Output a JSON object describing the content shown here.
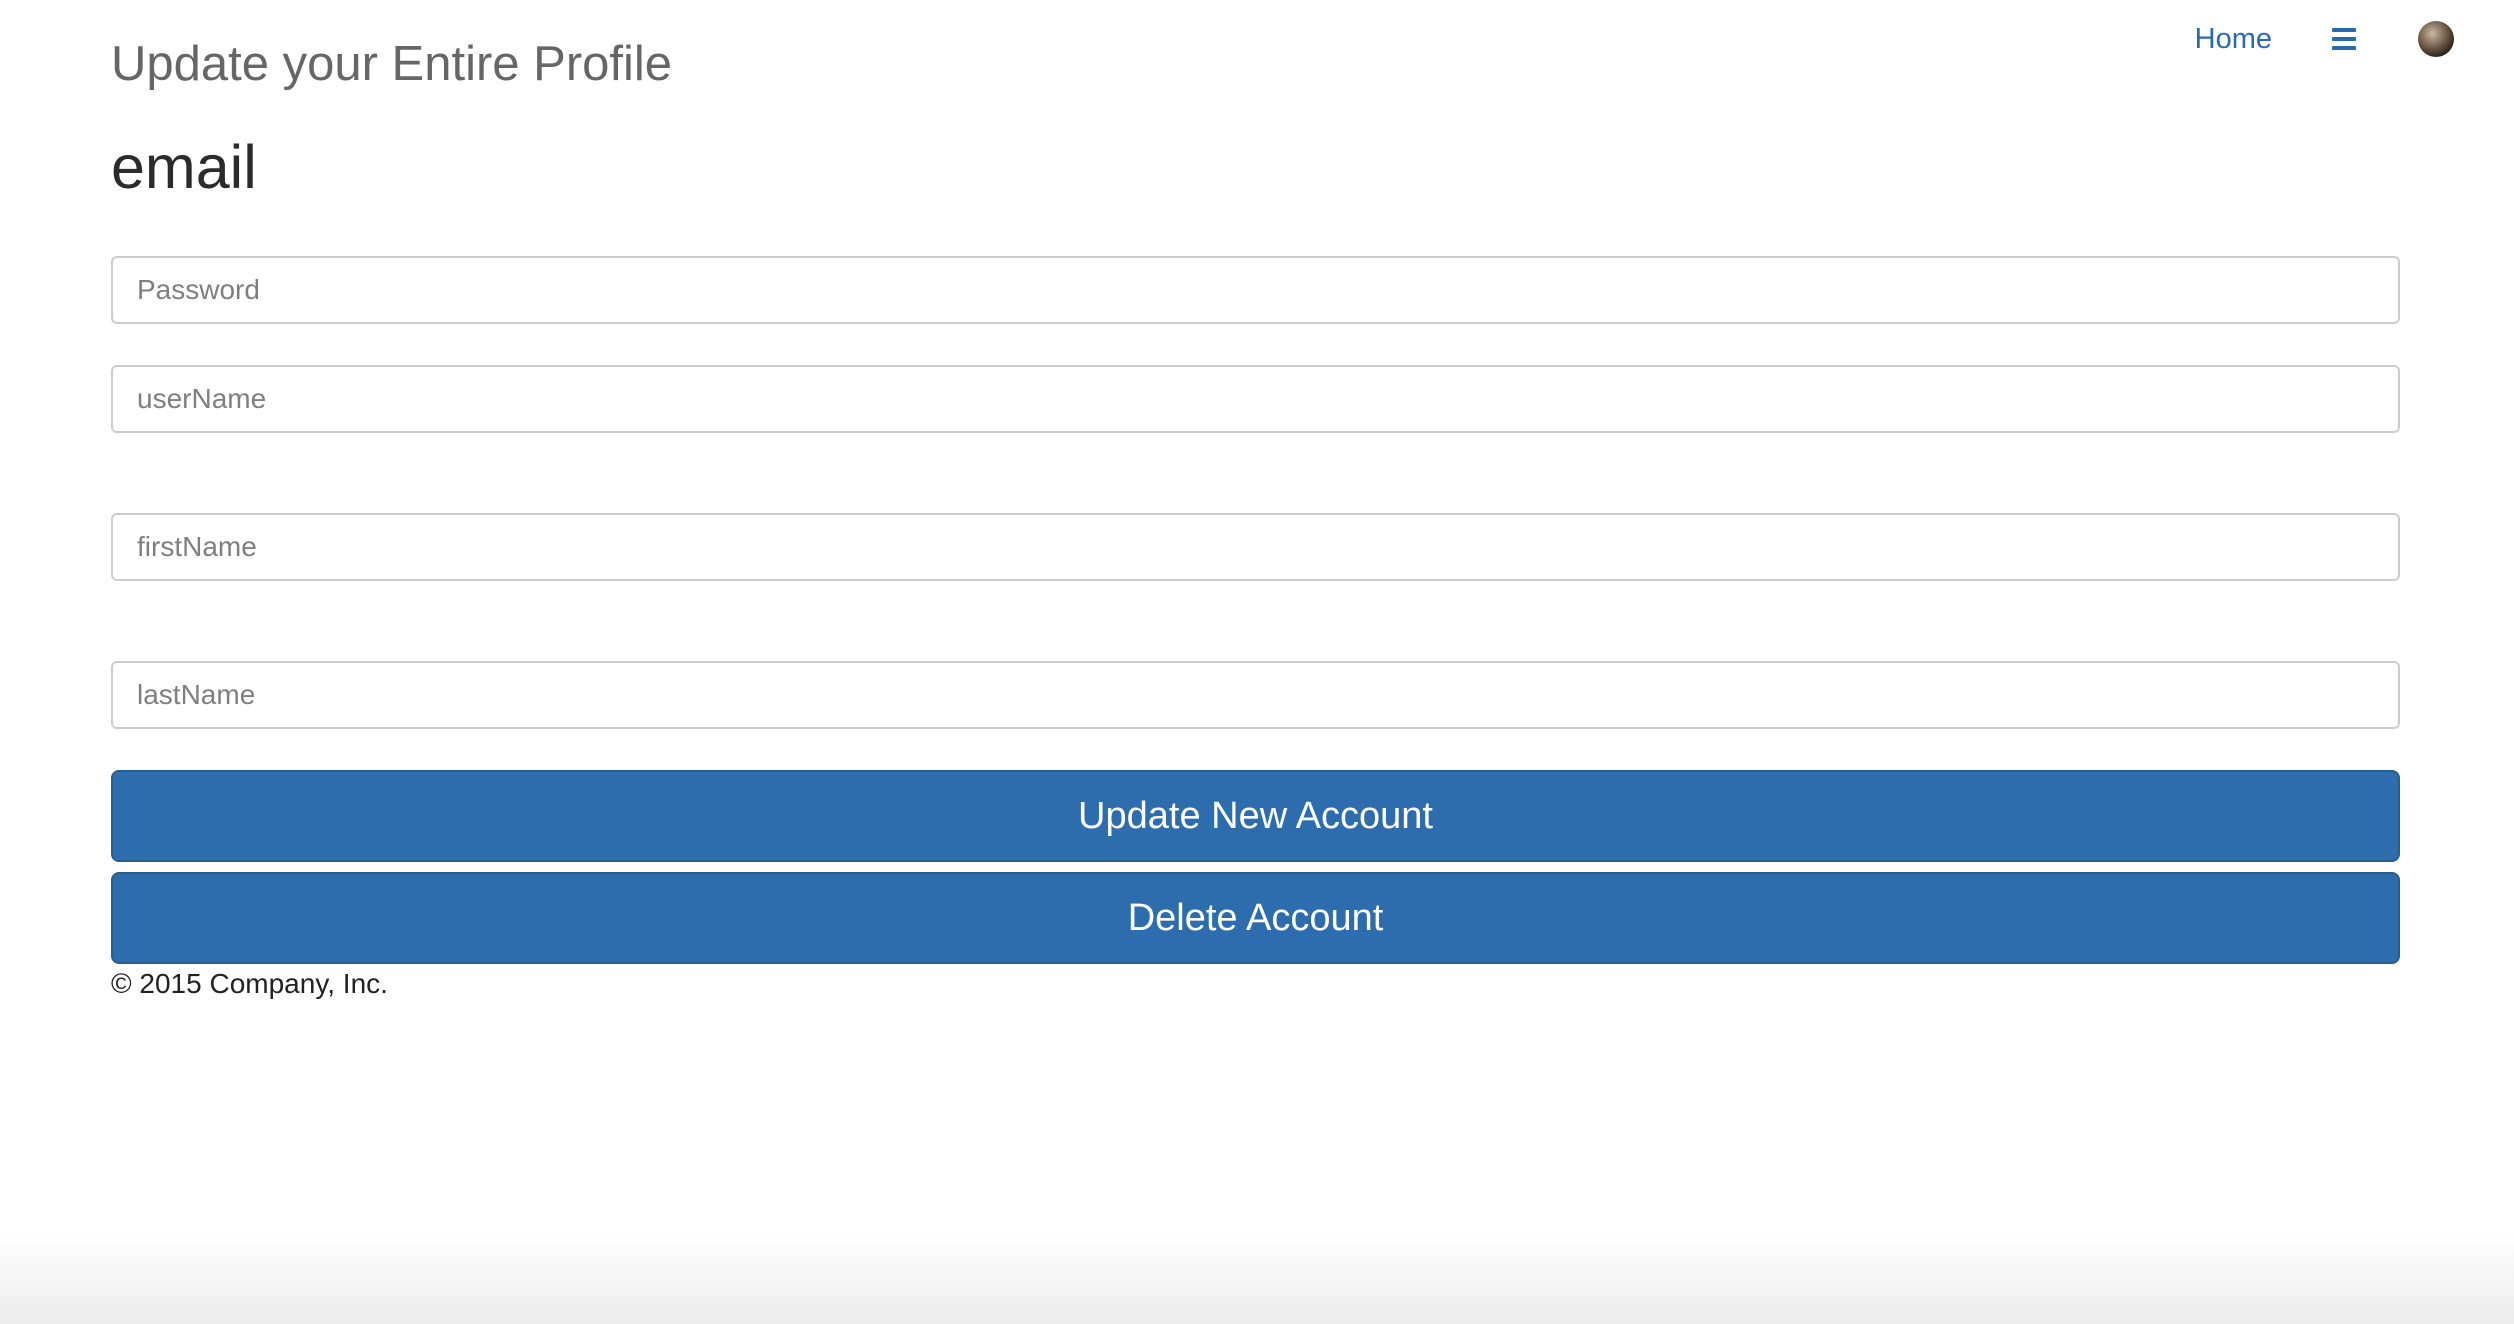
{
  "nav": {
    "home_label": "Home",
    "menu_icon": "hamburger-menu-icon",
    "avatar": "user-avatar"
  },
  "header": {
    "title": "Update your Entire Profile"
  },
  "section": {
    "heading": "email"
  },
  "form": {
    "password_placeholder": "Password",
    "username_placeholder": "userName",
    "firstname_placeholder": "firstName",
    "lastname_placeholder": "lastName",
    "update_label": "Update New Account",
    "delete_label": "Delete Account"
  },
  "footer": {
    "text": "© 2015 Company, Inc."
  },
  "colors": {
    "accent": "#2e6dad",
    "link": "#2a6bb0",
    "title": "#666666"
  }
}
